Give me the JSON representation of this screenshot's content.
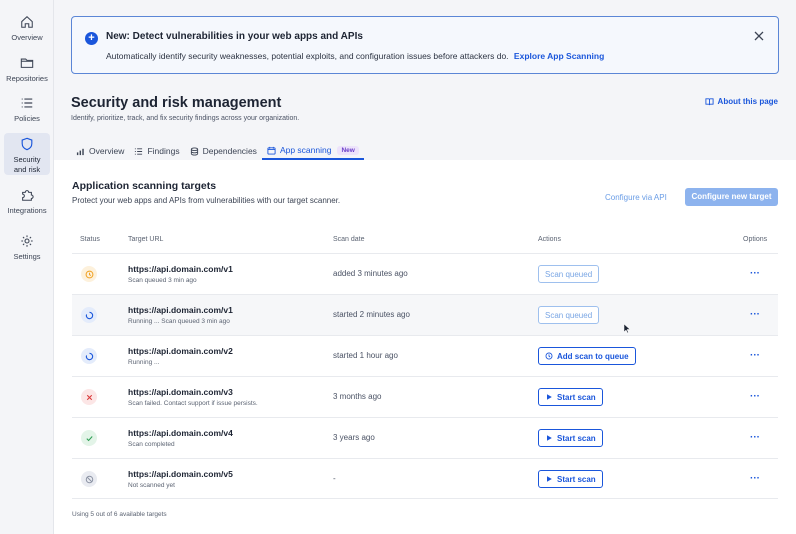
{
  "sidebar": {
    "items": [
      {
        "label": "Overview",
        "icon": "home-icon"
      },
      {
        "label": "Repositories",
        "icon": "folder-icon"
      },
      {
        "label": "Policies",
        "icon": "list-icon"
      },
      {
        "label": "Security and risk",
        "label_line1": "Security",
        "label_line2": "and risk",
        "icon": "shield-icon",
        "active": true
      },
      {
        "label": "Integrations",
        "icon": "puzzle-icon"
      },
      {
        "label": "Settings",
        "icon": "gear-icon"
      }
    ]
  },
  "banner": {
    "title": "New: Detect vulnerabilities in your web apps and APIs",
    "text": "Automatically identify security weaknesses, potential exploits, and configuration issues before attackers do.",
    "link": "Explore App Scanning"
  },
  "header": {
    "title": "Security and risk management",
    "subtitle": "Identify, prioritize, track, and fix security findings across your organization.",
    "about": "About this page"
  },
  "tabs": [
    {
      "label": "Overview",
      "icon": "bar-chart-icon"
    },
    {
      "label": "Findings",
      "icon": "list-icon"
    },
    {
      "label": "Dependencies",
      "icon": "layers-icon"
    },
    {
      "label": "App scanning",
      "icon": "window-icon",
      "active": true,
      "badge": "New"
    }
  ],
  "section": {
    "title": "Application scanning targets",
    "subtitle": "Protect your web apps and APIs from vulnerabilities with our target scanner.",
    "api_button": "Configure via API",
    "configure_button": "Configure new target"
  },
  "table": {
    "columns": {
      "status": "Status",
      "url": "Target URL",
      "date": "Scan date",
      "actions": "Actions",
      "options": "Options"
    },
    "rows": [
      {
        "status": "queued",
        "url": "https://api.domain.com/v1",
        "sub": "Scan queued 3 min ago",
        "date": "added 3 minutes ago",
        "action": "Scan queued",
        "action_style": "disabled",
        "options": "···"
      },
      {
        "status": "running",
        "url": "https://api.domain.com/v1",
        "sub": "Running ... Scan queued 3 min ago",
        "date": "started 2 minutes ago",
        "action": "Scan queued",
        "action_style": "disabled",
        "options": "···"
      },
      {
        "status": "running",
        "url": "https://api.domain.com/v2",
        "sub": "Running ...",
        "date": "started 1 hour ago",
        "action": "Add scan to queue",
        "action_style": "primary-clock",
        "options": "···"
      },
      {
        "status": "failed",
        "url": "https://api.domain.com/v3",
        "sub": "Scan failed. Contact support if issue persists.",
        "date": "3 months ago",
        "action": "Start scan",
        "action_style": "primary-play",
        "options": "···"
      },
      {
        "status": "completed",
        "url": "https://api.domain.com/v4",
        "sub": "Scan completed",
        "date": "3 years ago",
        "action": "Start scan",
        "action_style": "primary-play",
        "options": "···"
      },
      {
        "status": "not-scanned",
        "url": "https://api.domain.com/v5",
        "sub": "Not scanned yet",
        "date": "-",
        "action": "Start scan",
        "action_style": "primary-play",
        "options": "···"
      }
    ]
  },
  "footer": {
    "note": "Using 5 out of 6 available targets"
  },
  "colors": {
    "accent": "#1a56db",
    "queued": "#f0a020",
    "failed": "#d93a3a",
    "success": "#2f9e55",
    "muted": "#8a92a3"
  }
}
